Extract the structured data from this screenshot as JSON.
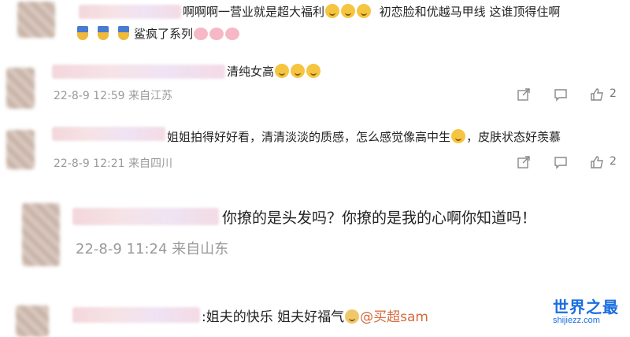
{
  "comments": [
    {
      "text_part1": "啊啊啊一营业就是超大福利",
      "text_part2": "初恋脸和优越马甲线  这谁顶得住啊",
      "line2_text": "鲨疯了系列",
      "date": "",
      "location": ""
    },
    {
      "text": "清纯女高",
      "date": "22-8-9 12:59",
      "location": "来自江苏",
      "like_count": "2"
    },
    {
      "text_part1": "姐姐拍得好好看，清清淡淡的质感，怎么感觉像高中生",
      "text_part2": "，皮肤状态好羡慕",
      "date": "22-8-9 12:21",
      "location": "来自四川",
      "like_count": "2"
    },
    {
      "text": "你撩的是头发吗？你撩的是我的心啊你知道吗！",
      "date": "22-8-9 11:24",
      "location": "来自山东"
    },
    {
      "text_part1": ":姐夫的快乐  姐夫好福气",
      "mention": "@买超sam"
    }
  ],
  "watermark": {
    "title": "世界之最",
    "url": "shijiezz.com"
  },
  "icons": [
    "share-icon",
    "comment-icon",
    "like-icon"
  ],
  "colors": {
    "meta_gray": "#9a9a9a",
    "watermark_blue": "#1b6fe0",
    "mention_orange": "#d6693a"
  }
}
